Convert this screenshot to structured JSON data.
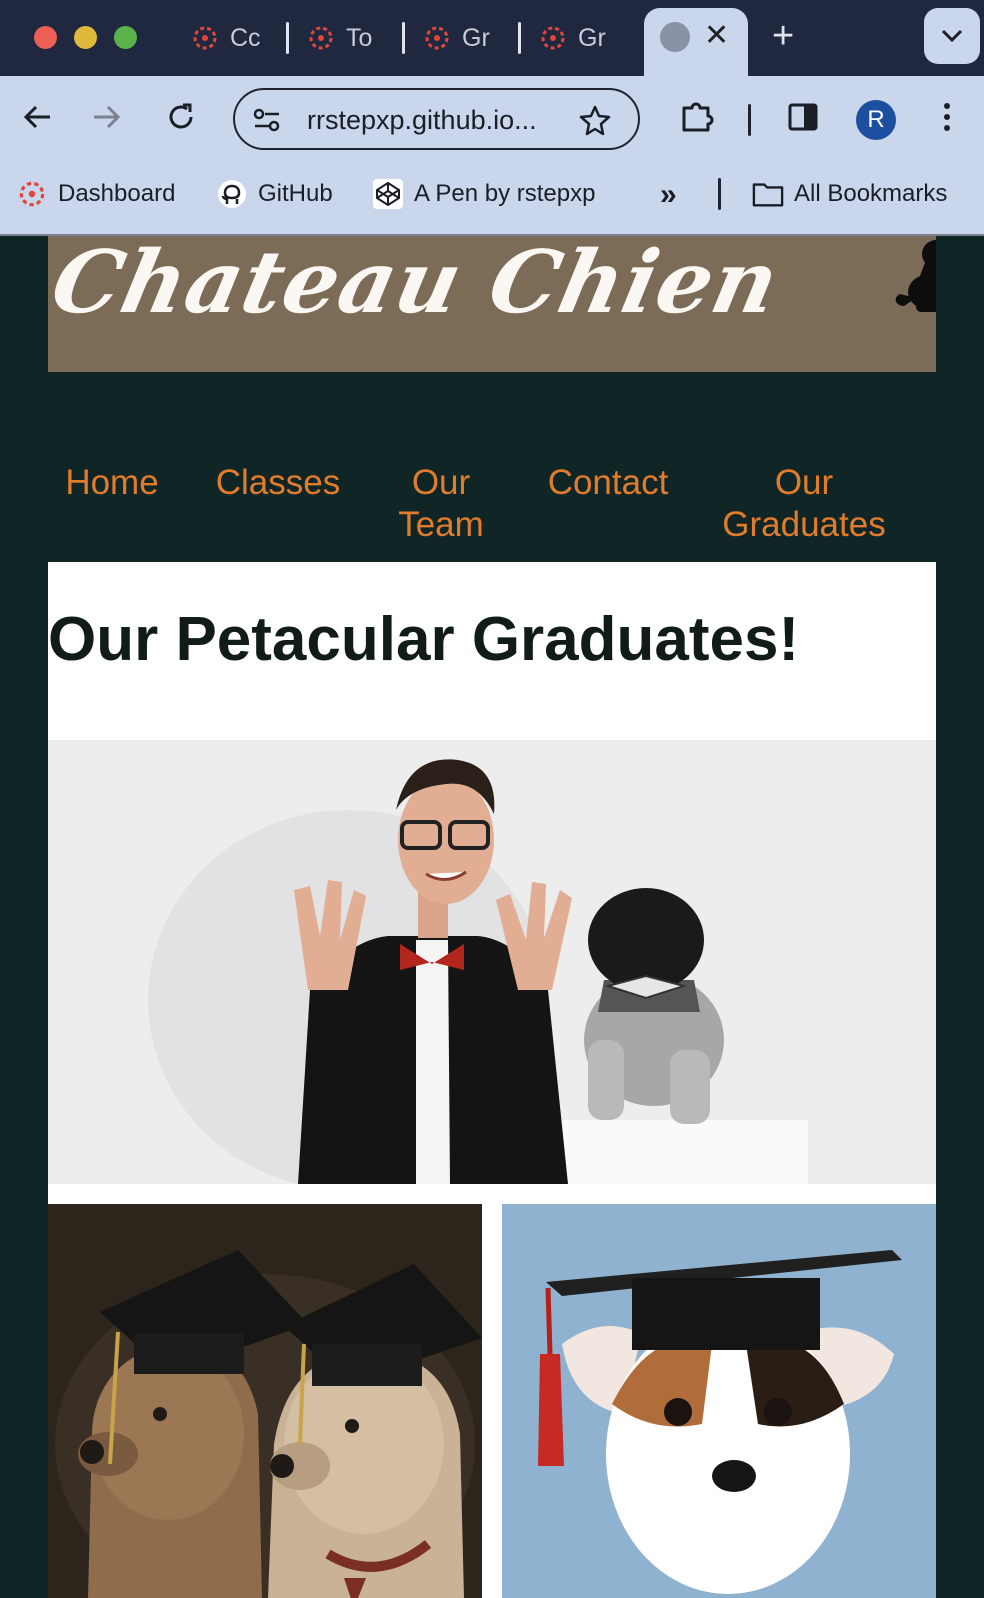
{
  "browser": {
    "tabs": [
      {
        "label": "Cc"
      },
      {
        "label": "To"
      },
      {
        "label": "Gr"
      },
      {
        "label": "Gr"
      }
    ],
    "active_tab_close": "✕",
    "new_tab": "+",
    "url": "rrstepxp.github.io...",
    "profile_initial": "R",
    "bookmarks": [
      {
        "label": "Dashboard"
      },
      {
        "label": "GitHub"
      },
      {
        "label": "A Pen by rstepxp"
      }
    ],
    "bookmarks_overflow": "»",
    "all_bookmarks": "All Bookmarks",
    "colors": {
      "accent": "#1d4fa0",
      "chrome": "#c9d6ec",
      "tabstrip": "#202840"
    }
  },
  "site": {
    "logo_text": "Chateau Chien",
    "nav": [
      {
        "label": "Home"
      },
      {
        "label": "Classes"
      },
      {
        "label": "Our Team"
      },
      {
        "label": "Contact"
      },
      {
        "label": "Our Graduates"
      }
    ],
    "heading": "Our Petacular Graduates!",
    "colors": {
      "background": "#102626",
      "banner": "#7c6c57",
      "nav": "#e07c2c"
    }
  }
}
